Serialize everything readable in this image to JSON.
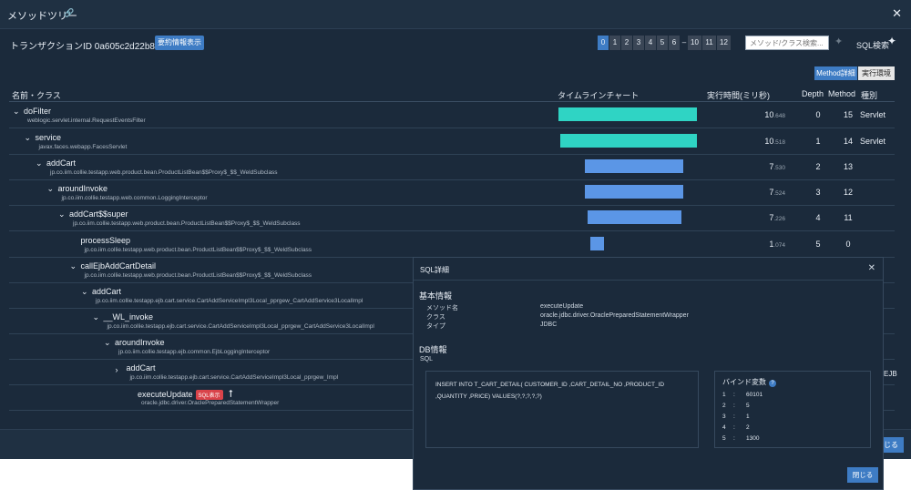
{
  "window": {
    "title": "メソッドツリー",
    "transaction_label": "トランザクションID",
    "transaction_id": "0a605c2d22b84418",
    "summary_button": "要約情報表示",
    "depth_pages": [
      "0",
      "1",
      "2",
      "3",
      "4",
      "5",
      "6",
      "–",
      "10",
      "11",
      "12"
    ],
    "active_depth": "0",
    "search_placeholder": "メソッド/クラス検索...",
    "sql_search_label": "SQL検索",
    "toggle_method_detail": "Method詳細",
    "toggle_env": "実行環境",
    "close_label_partial": "じる",
    "behind_text_partial": "EJB"
  },
  "columns": {
    "name": "名前・クラス",
    "timeline": "タイムラインチャート",
    "exec_time": "実行時間(ミリ秒)",
    "depth": "Depth",
    "method": "Method",
    "kind": "種別"
  },
  "rows": [
    {
      "name": "doFilter",
      "cls": "weblogic.servlet.internal.RequestEventsFilter",
      "time_int": "10",
      "time_dec": ".648",
      "depth": "0",
      "methods": "15",
      "kind": "Servlet",
      "bar_start": 0.0,
      "bar_len": 1.0,
      "bar_color": "#2fd4c4"
    },
    {
      "name": "service",
      "cls": "javax.faces.webapp.FacesServlet",
      "time_int": "10",
      "time_dec": ".518",
      "depth": "1",
      "methods": "14",
      "kind": "Servlet",
      "bar_start": 0.01,
      "bar_len": 0.99,
      "bar_color": "#2fd4c4"
    },
    {
      "name": "addCart",
      "cls": "jp.co.iim.collie.testapp.web.product.bean.ProductListBean$$Proxy$_$$_WeldSubclass",
      "time_int": "7",
      "time_dec": ".530",
      "depth": "2",
      "methods": "13",
      "kind": "",
      "bar_start": 0.19,
      "bar_len": 0.71,
      "bar_color": "#5b96e6"
    },
    {
      "name": "aroundInvoke",
      "cls": "jp.co.iim.collie.testapp.web.common.LoggingInterceptor",
      "time_int": "7",
      "time_dec": ".524",
      "depth": "3",
      "methods": "12",
      "kind": "",
      "bar_start": 0.19,
      "bar_len": 0.71,
      "bar_color": "#5b96e6"
    },
    {
      "name": "addCart$$super",
      "cls": "jp.co.iim.collie.testapp.web.product.bean.ProductListBean$$Proxy$_$$_WeldSubclass",
      "time_int": "7",
      "time_dec": ".226",
      "depth": "4",
      "methods": "11",
      "kind": "",
      "bar_start": 0.21,
      "bar_len": 0.68,
      "bar_color": "#5b96e6"
    },
    {
      "name": "processSleep",
      "cls": "jp.co.iim.collie.testapp.web.product.bean.ProductListBean$$Proxy$_$$_WeldSubclass",
      "time_int": "1",
      "time_dec": ".074",
      "depth": "5",
      "methods": "0",
      "kind": "",
      "bar_start": 0.23,
      "bar_len": 0.1,
      "bar_color": "#5b96e6"
    },
    {
      "name": "callEjbAddCartDetail",
      "cls": "jp.co.iim.collie.testapp.web.product.bean.ProductListBean$$Proxy$_$$_WeldSubclass",
      "time_int": "",
      "time_dec": "",
      "depth": "",
      "methods": "",
      "kind": ""
    },
    {
      "name": "addCart",
      "cls": "jp.co.iim.collie.testapp.ejb.cart.service.CartAddServiceImpl3Local_pprgew_CartAddService3LocalImpl",
      "time_int": "",
      "time_dec": "",
      "depth": "",
      "methods": "",
      "kind": ""
    },
    {
      "name": "__WL_invoke",
      "cls": "jp.co.iim.collie.testapp.ejb.cart.service.CartAddServiceImpl3Local_pprgew_CartAddService3LocalImpl",
      "time_int": "",
      "time_dec": "",
      "depth": "",
      "methods": "",
      "kind": ""
    },
    {
      "name": "aroundInvoke",
      "cls": "jp.co.iim.collie.testapp.ejb.common.EjbLoggingInterceptor",
      "time_int": "",
      "time_dec": "",
      "depth": "",
      "methods": "",
      "kind": ""
    },
    {
      "name": "addCart",
      "cls": "jp.co.iim.collie.testapp.ejb.cart.service.CartAddServiceImpl3Local_pprgew_Impl",
      "time_int": "",
      "time_dec": "",
      "depth": "",
      "methods": "",
      "kind": ""
    },
    {
      "name": "executeUpdate",
      "cls": "oracle.jdbc.driver.OraclePreparedStatementWrapper",
      "time_int": "",
      "time_dec": "",
      "depth": "",
      "methods": "",
      "kind": "",
      "badge": "SQL表示"
    }
  ],
  "sql_dialog": {
    "title": "SQL詳細",
    "basic_section": "基本情報",
    "method_label": "メソッド名",
    "method_value": "executeUpdate",
    "class_label": "クラス",
    "class_value": "oracle.jdbc.driver.OraclePreparedStatementWrapper",
    "type_label": "タイプ",
    "type_value": "JDBC",
    "db_section": "DB情報",
    "sql_label": "SQL",
    "sql_line1": "INSERT INTO T_CART_DETAIL( CUSTOMER_ID ,CART_DETAIL_NO ,PRODUCT_ID",
    "sql_line2": ",QUANTITY ,PRICE) VALUES(?,?,?,?,?)",
    "bind_title": "バインド変数",
    "binds": [
      {
        "idx": "1",
        "val": "60101"
      },
      {
        "idx": "2",
        "val": "5"
      },
      {
        "idx": "3",
        "val": "1"
      },
      {
        "idx": "4",
        "val": "2"
      },
      {
        "idx": "5",
        "val": "1300"
      }
    ],
    "close_button": "閉じる"
  }
}
